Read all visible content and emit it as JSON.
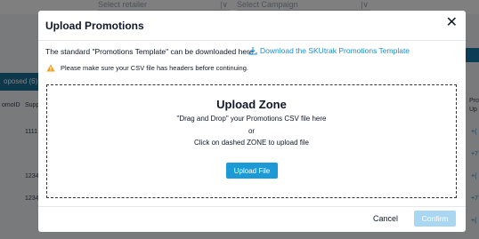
{
  "background": {
    "select_retailer": "Select retailer",
    "select_campaign": "Select Campaign",
    "tab_label": "oposed (6)",
    "col_promo_id": "omoID",
    "col_supplier": "Supp",
    "col_pro": "Pro",
    "col_pro2": "Up",
    "row_values": [
      "1111",
      "1234",
      "1234"
    ],
    "row_links": [
      "+(",
      "+7",
      "+(",
      "+7",
      "+("
    ]
  },
  "modal": {
    "title": "Upload Promotions",
    "close_symbol": "✕",
    "template_text": "The standard \"Promotions Template\" can be downloaded here",
    "download_link": "Download the SKUtrak Promotions Template",
    "warning_text": "Please make sure your CSV file has headers before continuing.",
    "upload_zone": {
      "title": "Upload Zone",
      "line1": "\"Drag and Drop\" your Promotions CSV file here",
      "line2": "or",
      "line3": "Click on dashed ZONE to upload file",
      "button": "Upload File"
    },
    "footer": {
      "cancel": "Cancel",
      "confirm": "Confirm"
    }
  },
  "colors": {
    "accent": "#1b9ad6",
    "link": "#1c8cc7",
    "confirm_disabled": "#a9d7f2",
    "warning": "#f0a020"
  },
  "icons": {
    "download": "download-icon",
    "warning": "warning-icon",
    "close": "close-icon"
  }
}
